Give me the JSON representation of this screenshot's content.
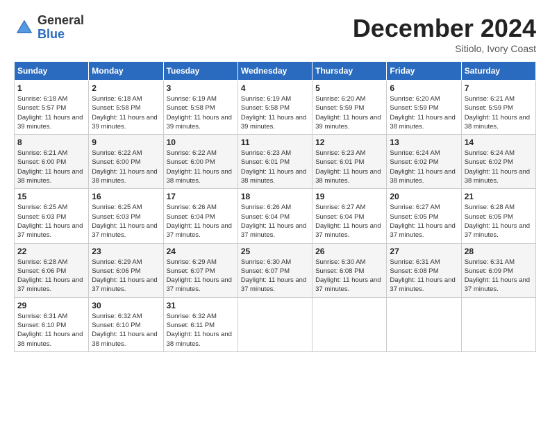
{
  "logo": {
    "general": "General",
    "blue": "Blue"
  },
  "title": "December 2024",
  "subtitle": "Sitiolo, Ivory Coast",
  "days_header": [
    "Sunday",
    "Monday",
    "Tuesday",
    "Wednesday",
    "Thursday",
    "Friday",
    "Saturday"
  ],
  "weeks": [
    [
      {
        "day": "1",
        "sunrise": "6:18 AM",
        "sunset": "5:57 PM",
        "daylight": "11 hours and 39 minutes."
      },
      {
        "day": "2",
        "sunrise": "6:18 AM",
        "sunset": "5:58 PM",
        "daylight": "11 hours and 39 minutes."
      },
      {
        "day": "3",
        "sunrise": "6:19 AM",
        "sunset": "5:58 PM",
        "daylight": "11 hours and 39 minutes."
      },
      {
        "day": "4",
        "sunrise": "6:19 AM",
        "sunset": "5:58 PM",
        "daylight": "11 hours and 39 minutes."
      },
      {
        "day": "5",
        "sunrise": "6:20 AM",
        "sunset": "5:59 PM",
        "daylight": "11 hours and 39 minutes."
      },
      {
        "day": "6",
        "sunrise": "6:20 AM",
        "sunset": "5:59 PM",
        "daylight": "11 hours and 38 minutes."
      },
      {
        "day": "7",
        "sunrise": "6:21 AM",
        "sunset": "5:59 PM",
        "daylight": "11 hours and 38 minutes."
      }
    ],
    [
      {
        "day": "8",
        "sunrise": "6:21 AM",
        "sunset": "6:00 PM",
        "daylight": "11 hours and 38 minutes."
      },
      {
        "day": "9",
        "sunrise": "6:22 AM",
        "sunset": "6:00 PM",
        "daylight": "11 hours and 38 minutes."
      },
      {
        "day": "10",
        "sunrise": "6:22 AM",
        "sunset": "6:00 PM",
        "daylight": "11 hours and 38 minutes."
      },
      {
        "day": "11",
        "sunrise": "6:23 AM",
        "sunset": "6:01 PM",
        "daylight": "11 hours and 38 minutes."
      },
      {
        "day": "12",
        "sunrise": "6:23 AM",
        "sunset": "6:01 PM",
        "daylight": "11 hours and 38 minutes."
      },
      {
        "day": "13",
        "sunrise": "6:24 AM",
        "sunset": "6:02 PM",
        "daylight": "11 hours and 38 minutes."
      },
      {
        "day": "14",
        "sunrise": "6:24 AM",
        "sunset": "6:02 PM",
        "daylight": "11 hours and 38 minutes."
      }
    ],
    [
      {
        "day": "15",
        "sunrise": "6:25 AM",
        "sunset": "6:03 PM",
        "daylight": "11 hours and 37 minutes."
      },
      {
        "day": "16",
        "sunrise": "6:25 AM",
        "sunset": "6:03 PM",
        "daylight": "11 hours and 37 minutes."
      },
      {
        "day": "17",
        "sunrise": "6:26 AM",
        "sunset": "6:04 PM",
        "daylight": "11 hours and 37 minutes."
      },
      {
        "day": "18",
        "sunrise": "6:26 AM",
        "sunset": "6:04 PM",
        "daylight": "11 hours and 37 minutes."
      },
      {
        "day": "19",
        "sunrise": "6:27 AM",
        "sunset": "6:04 PM",
        "daylight": "11 hours and 37 minutes."
      },
      {
        "day": "20",
        "sunrise": "6:27 AM",
        "sunset": "6:05 PM",
        "daylight": "11 hours and 37 minutes."
      },
      {
        "day": "21",
        "sunrise": "6:28 AM",
        "sunset": "6:05 PM",
        "daylight": "11 hours and 37 minutes."
      }
    ],
    [
      {
        "day": "22",
        "sunrise": "6:28 AM",
        "sunset": "6:06 PM",
        "daylight": "11 hours and 37 minutes."
      },
      {
        "day": "23",
        "sunrise": "6:29 AM",
        "sunset": "6:06 PM",
        "daylight": "11 hours and 37 minutes."
      },
      {
        "day": "24",
        "sunrise": "6:29 AM",
        "sunset": "6:07 PM",
        "daylight": "11 hours and 37 minutes."
      },
      {
        "day": "25",
        "sunrise": "6:30 AM",
        "sunset": "6:07 PM",
        "daylight": "11 hours and 37 minutes."
      },
      {
        "day": "26",
        "sunrise": "6:30 AM",
        "sunset": "6:08 PM",
        "daylight": "11 hours and 37 minutes."
      },
      {
        "day": "27",
        "sunrise": "6:31 AM",
        "sunset": "6:08 PM",
        "daylight": "11 hours and 37 minutes."
      },
      {
        "day": "28",
        "sunrise": "6:31 AM",
        "sunset": "6:09 PM",
        "daylight": "11 hours and 37 minutes."
      }
    ],
    [
      {
        "day": "29",
        "sunrise": "6:31 AM",
        "sunset": "6:10 PM",
        "daylight": "11 hours and 38 minutes."
      },
      {
        "day": "30",
        "sunrise": "6:32 AM",
        "sunset": "6:10 PM",
        "daylight": "11 hours and 38 minutes."
      },
      {
        "day": "31",
        "sunrise": "6:32 AM",
        "sunset": "6:11 PM",
        "daylight": "11 hours and 38 minutes."
      },
      null,
      null,
      null,
      null
    ]
  ]
}
